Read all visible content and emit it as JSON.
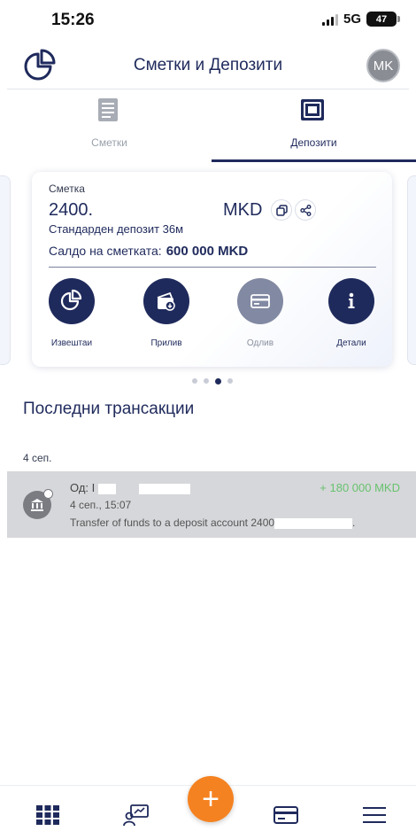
{
  "status_bar": {
    "time": "15:26",
    "network": "5G",
    "battery": "47"
  },
  "header": {
    "title": "Сметки и Депозити",
    "avatar_initials": "MK"
  },
  "tabs": [
    {
      "label": "Сметки",
      "active": false
    },
    {
      "label": "Депозити",
      "active": true
    }
  ],
  "account_card": {
    "caption": "Сметка",
    "number": "2400.",
    "currency": "MKD",
    "product": "Стандарден депозит 36м",
    "balance_label": "Салдо на сметката:",
    "balance_value": "600 000 MKD",
    "actions": [
      {
        "label": "Извештаи",
        "icon": "reports-chart-icon",
        "enabled": true
      },
      {
        "label": "Прилив",
        "icon": "inflow-wallet-icon",
        "enabled": true
      },
      {
        "label": "Одлив",
        "icon": "outflow-card-icon",
        "enabled": false
      },
      {
        "label": "Детали",
        "icon": "info-icon",
        "enabled": true
      }
    ]
  },
  "carousel": {
    "pages": 4,
    "active_page": 3
  },
  "transactions": {
    "title": "Последни трансакции",
    "groups": [
      {
        "date": "4 сеп.",
        "items": [
          {
            "from_prefix": "Од: I",
            "amount": "+ 180 000 MKD",
            "datetime": "4 сеп., 15:07",
            "description": "Transfer of funds to a deposit account 2400",
            "description_suffix": "."
          }
        ]
      }
    ]
  },
  "colors": {
    "primary": "#1f2a5c",
    "accent": "#f58220",
    "positive": "#67c26f"
  },
  "bottom_nav": {
    "items": [
      "apps-grid-icon",
      "transfer-icon",
      "add-icon",
      "cards-icon",
      "menu-icon"
    ],
    "fab_symbol": "+"
  }
}
